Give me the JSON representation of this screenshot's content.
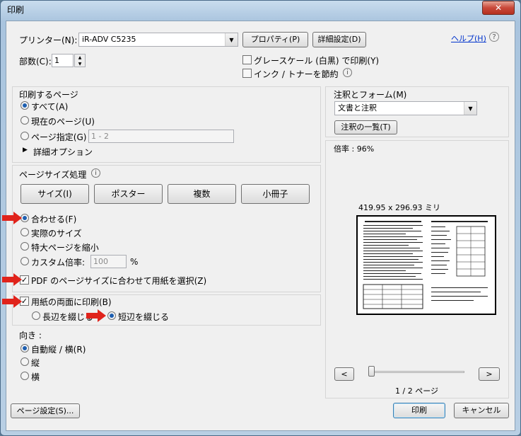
{
  "window": {
    "title": "印刷",
    "close_label": "✕"
  },
  "printer": {
    "label": "プリンター(N):",
    "value": "iR-ADV C5235",
    "properties": "プロパティ(P)",
    "advanced": "詳細設定(D)",
    "help": "ヘルプ(H)"
  },
  "copies": {
    "label": "部数(C):",
    "value": "1"
  },
  "options": {
    "grayscale": "グレースケール (白黒) で印刷(Y)",
    "ink_save": "インク / トナーを節約"
  },
  "pages": {
    "heading": "印刷するページ",
    "all": "すべて(A)",
    "current": "現在のページ(U)",
    "range": "ページ指定(G)",
    "range_placeholder": "1 - 2",
    "more": "詳細オプション"
  },
  "size": {
    "heading": "ページサイズ処理",
    "tabs": [
      "サイズ(I)",
      "ポスター",
      "複数",
      "小冊子"
    ],
    "fit": "合わせる(F)",
    "actual": "実際のサイズ",
    "shrink": "特大ページを縮小",
    "custom": "カスタム倍率:",
    "custom_value": "100",
    "percent": "%",
    "pdf_paper": "PDF のページサイズに合わせて用紙を選択(Z)"
  },
  "duplex": {
    "label": "用紙の両面に印刷(B)",
    "long": "長辺を綴じる",
    "short": "短辺を綴じる"
  },
  "orientation": {
    "heading": "向き :",
    "auto": "自動縦 / 横(R)",
    "portrait": "縦",
    "landscape": "横"
  },
  "annot": {
    "heading": "注釈とフォーム(M)",
    "value": "文書と注釈",
    "summary": "注釈の一覧(T)"
  },
  "preview": {
    "zoom": "倍率 : 96%",
    "size": "419.95 x 296.93 ミリ",
    "page": "1 / 2 ページ",
    "prev": "<",
    "next": ">"
  },
  "footer": {
    "page_setup": "ページ設定(S)...",
    "print": "印刷",
    "cancel": "キャンセル"
  },
  "colors": {
    "accent": "#1e5fb0",
    "arrow": "#e0231b"
  }
}
